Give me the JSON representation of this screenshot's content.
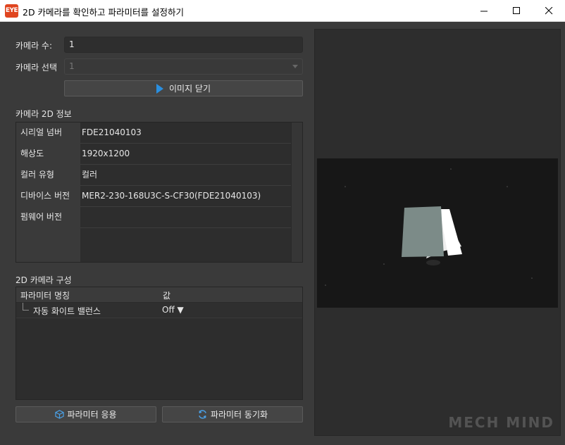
{
  "window": {
    "title": "2D 카메라를 확인하고 파라미터를 설정하기",
    "app_icon_text": "EYE"
  },
  "camera_count": {
    "label": "카메라 수:",
    "value": "1"
  },
  "camera_select": {
    "label": "카메라 선택",
    "value": "1"
  },
  "close_image_button": {
    "label": "이미지 닫기",
    "icon": "play-icon",
    "icon_color": "#2a8fe0"
  },
  "info_section": {
    "title": "카메라 2D 정보",
    "rows": [
      {
        "key": "시리얼 넘버",
        "value": "FDE21040103"
      },
      {
        "key": "해상도",
        "value": "1920x1200"
      },
      {
        "key": "컬러 유형",
        "value": "컬러"
      },
      {
        "key": "디바이스 버전",
        "value": "MER2-230-168U3C-S-CF30(FDE21040103)"
      },
      {
        "key": "펌웨어 버전",
        "value": ""
      }
    ]
  },
  "config_section": {
    "title": "2D 카메라 구성",
    "headers": [
      "파라미터 명칭",
      "값"
    ],
    "rows": [
      {
        "name": "자동 화이트 밸런스",
        "value": "Off ▼"
      }
    ]
  },
  "footer_buttons": {
    "apply": {
      "label": "파라미터 응용",
      "icon": "cube-icon"
    },
    "sync": {
      "label": "파라미터 동기화",
      "icon": "refresh-icon"
    }
  },
  "watermark": "MECH MIND",
  "colors": {
    "accent": "#2a8fe0",
    "app_icon": "#e0451f",
    "panel_bg": "#3a3a3a"
  }
}
